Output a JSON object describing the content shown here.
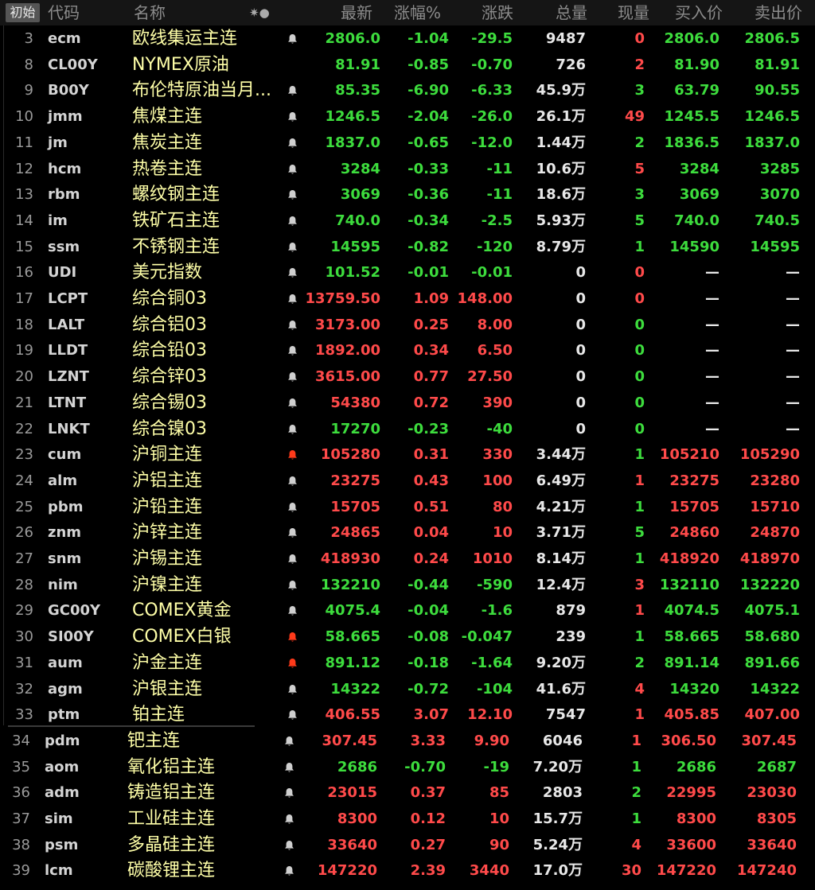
{
  "header": {
    "init_button": "初始",
    "columns": {
      "code": "代码",
      "name": "名称",
      "latest": "最新",
      "change_pct": "涨幅%",
      "change": "涨跌",
      "volume": "总量",
      "current_vol": "现量",
      "bid": "买入价",
      "ask": "卖出价"
    },
    "icons": "✷●"
  },
  "colors": {
    "up": "#ff4a4a",
    "down": "#3ddc3d",
    "name": "#ffffa8",
    "alert_bell": "#ff3a1a",
    "bell": "#cfcfcf"
  },
  "rows": [
    {
      "idx": "3",
      "code": "ecm",
      "name": "欧线集运主连",
      "latest": "2806.0",
      "pct": "-1.04",
      "chg": "-29.5",
      "vol": "9487",
      "cur": "0",
      "bid": "2806.0",
      "ask": "2806.5",
      "dir": "down",
      "bid_dir": "down",
      "ask_dir": "down",
      "cur_dir": "up",
      "bell": "normal"
    },
    {
      "idx": "8",
      "code": "CL00Y",
      "name": "NYMEX原油",
      "latest": "81.91",
      "pct": "-0.85",
      "chg": "-0.70",
      "vol": "726",
      "cur": "2",
      "bid": "81.90",
      "ask": "81.91",
      "dir": "down",
      "bid_dir": "down",
      "ask_dir": "down",
      "cur_dir": "up",
      "bell": "none"
    },
    {
      "idx": "9",
      "code": "B00Y",
      "name": "布伦特原油当月...",
      "latest": "85.35",
      "pct": "-6.90",
      "chg": "-6.33",
      "vol": "45.9万",
      "cur": "3",
      "bid": "63.79",
      "ask": "90.55",
      "dir": "down",
      "bid_dir": "down",
      "ask_dir": "down",
      "cur_dir": "down",
      "bell": "normal"
    },
    {
      "idx": "10",
      "code": "jmm",
      "name": "焦煤主连",
      "latest": "1246.5",
      "pct": "-2.04",
      "chg": "-26.0",
      "vol": "26.1万",
      "cur": "49",
      "bid": "1245.5",
      "ask": "1246.5",
      "dir": "down",
      "bid_dir": "down",
      "ask_dir": "down",
      "cur_dir": "up",
      "bell": "normal"
    },
    {
      "idx": "11",
      "code": "jm",
      "name": "焦炭主连",
      "latest": "1837.0",
      "pct": "-0.65",
      "chg": "-12.0",
      "vol": "1.44万",
      "cur": "2",
      "bid": "1836.5",
      "ask": "1837.0",
      "dir": "down",
      "bid_dir": "down",
      "ask_dir": "down",
      "cur_dir": "down",
      "bell": "normal"
    },
    {
      "idx": "12",
      "code": "hcm",
      "name": "热卷主连",
      "latest": "3284",
      "pct": "-0.33",
      "chg": "-11",
      "vol": "10.6万",
      "cur": "5",
      "bid": "3284",
      "ask": "3285",
      "dir": "down",
      "bid_dir": "down",
      "ask_dir": "down",
      "cur_dir": "up",
      "bell": "normal"
    },
    {
      "idx": "13",
      "code": "rbm",
      "name": "螺纹钢主连",
      "latest": "3069",
      "pct": "-0.36",
      "chg": "-11",
      "vol": "18.6万",
      "cur": "3",
      "bid": "3069",
      "ask": "3070",
      "dir": "down",
      "bid_dir": "down",
      "ask_dir": "down",
      "cur_dir": "down",
      "bell": "normal"
    },
    {
      "idx": "14",
      "code": "im",
      "name": "铁矿石主连",
      "latest": "740.0",
      "pct": "-0.34",
      "chg": "-2.5",
      "vol": "5.93万",
      "cur": "5",
      "bid": "740.0",
      "ask": "740.5",
      "dir": "down",
      "bid_dir": "down",
      "ask_dir": "down",
      "cur_dir": "down",
      "bell": "normal"
    },
    {
      "idx": "15",
      "code": "ssm",
      "name": "不锈钢主连",
      "latest": "14595",
      "pct": "-0.82",
      "chg": "-120",
      "vol": "8.79万",
      "cur": "1",
      "bid": "14590",
      "ask": "14595",
      "dir": "down",
      "bid_dir": "down",
      "ask_dir": "down",
      "cur_dir": "down",
      "bell": "normal"
    },
    {
      "idx": "16",
      "code": "UDI",
      "name": "美元指数",
      "latest": "101.52",
      "pct": "-0.01",
      "chg": "-0.01",
      "vol": "0",
      "cur": "0",
      "bid": "—",
      "ask": "—",
      "dir": "down",
      "bid_dir": "neutral",
      "ask_dir": "neutral",
      "cur_dir": "up",
      "bell": "normal"
    },
    {
      "idx": "17",
      "code": "LCPT",
      "name": "综合铜03",
      "latest": "13759.50",
      "pct": "1.09",
      "chg": "148.00",
      "vol": "0",
      "cur": "0",
      "bid": "—",
      "ask": "—",
      "dir": "up",
      "bid_dir": "neutral",
      "ask_dir": "neutral",
      "cur_dir": "up",
      "bell": "normal"
    },
    {
      "idx": "18",
      "code": "LALT",
      "name": "综合铝03",
      "latest": "3173.00",
      "pct": "0.25",
      "chg": "8.00",
      "vol": "0",
      "cur": "0",
      "bid": "—",
      "ask": "—",
      "dir": "up",
      "bid_dir": "neutral",
      "ask_dir": "neutral",
      "cur_dir": "down",
      "bell": "normal"
    },
    {
      "idx": "19",
      "code": "LLDT",
      "name": "综合铅03",
      "latest": "1892.00",
      "pct": "0.34",
      "chg": "6.50",
      "vol": "0",
      "cur": "0",
      "bid": "—",
      "ask": "—",
      "dir": "up",
      "bid_dir": "neutral",
      "ask_dir": "neutral",
      "cur_dir": "down",
      "bell": "normal"
    },
    {
      "idx": "20",
      "code": "LZNT",
      "name": "综合锌03",
      "latest": "3615.00",
      "pct": "0.77",
      "chg": "27.50",
      "vol": "0",
      "cur": "0",
      "bid": "—",
      "ask": "—",
      "dir": "up",
      "bid_dir": "neutral",
      "ask_dir": "neutral",
      "cur_dir": "down",
      "bell": "normal"
    },
    {
      "idx": "21",
      "code": "LTNT",
      "name": "综合锡03",
      "latest": "54380",
      "pct": "0.72",
      "chg": "390",
      "vol": "0",
      "cur": "0",
      "bid": "—",
      "ask": "—",
      "dir": "up",
      "bid_dir": "neutral",
      "ask_dir": "neutral",
      "cur_dir": "down",
      "bell": "normal"
    },
    {
      "idx": "22",
      "code": "LNKT",
      "name": "综合镍03",
      "latest": "17270",
      "pct": "-0.23",
      "chg": "-40",
      "vol": "0",
      "cur": "0",
      "bid": "—",
      "ask": "—",
      "dir": "down",
      "bid_dir": "neutral",
      "ask_dir": "neutral",
      "cur_dir": "down",
      "bell": "normal"
    },
    {
      "idx": "23",
      "code": "cum",
      "name": "沪铜主连",
      "latest": "105280",
      "pct": "0.31",
      "chg": "330",
      "vol": "3.44万",
      "cur": "1",
      "bid": "105210",
      "ask": "105290",
      "dir": "up",
      "bid_dir": "up",
      "ask_dir": "up",
      "cur_dir": "down",
      "bell": "alert"
    },
    {
      "idx": "24",
      "code": "alm",
      "name": "沪铝主连",
      "latest": "23275",
      "pct": "0.43",
      "chg": "100",
      "vol": "6.49万",
      "cur": "1",
      "bid": "23275",
      "ask": "23280",
      "dir": "up",
      "bid_dir": "up",
      "ask_dir": "up",
      "cur_dir": "up",
      "bell": "normal"
    },
    {
      "idx": "25",
      "code": "pbm",
      "name": "沪铅主连",
      "latest": "15705",
      "pct": "0.51",
      "chg": "80",
      "vol": "4.21万",
      "cur": "1",
      "bid": "15705",
      "ask": "15710",
      "dir": "up",
      "bid_dir": "up",
      "ask_dir": "up",
      "cur_dir": "down",
      "bell": "normal"
    },
    {
      "idx": "26",
      "code": "znm",
      "name": "沪锌主连",
      "latest": "24865",
      "pct": "0.04",
      "chg": "10",
      "vol": "3.71万",
      "cur": "5",
      "bid": "24860",
      "ask": "24870",
      "dir": "up",
      "bid_dir": "up",
      "ask_dir": "up",
      "cur_dir": "down",
      "bell": "normal"
    },
    {
      "idx": "27",
      "code": "snm",
      "name": "沪锡主连",
      "latest": "418930",
      "pct": "0.24",
      "chg": "1010",
      "vol": "8.14万",
      "cur": "1",
      "bid": "418920",
      "ask": "418970",
      "dir": "up",
      "bid_dir": "up",
      "ask_dir": "up",
      "cur_dir": "down",
      "bell": "normal"
    },
    {
      "idx": "28",
      "code": "nim",
      "name": "沪镍主连",
      "latest": "132210",
      "pct": "-0.44",
      "chg": "-590",
      "vol": "12.4万",
      "cur": "3",
      "bid": "132110",
      "ask": "132220",
      "dir": "down",
      "bid_dir": "down",
      "ask_dir": "down",
      "cur_dir": "up",
      "bell": "normal"
    },
    {
      "idx": "29",
      "code": "GC00Y",
      "name": "COMEX黄金",
      "latest": "4075.4",
      "pct": "-0.04",
      "chg": "-1.6",
      "vol": "879",
      "cur": "1",
      "bid": "4074.5",
      "ask": "4075.1",
      "dir": "down",
      "bid_dir": "down",
      "ask_dir": "down",
      "cur_dir": "up",
      "bell": "normal"
    },
    {
      "idx": "30",
      "code": "SI00Y",
      "name": "COMEX白银",
      "latest": "58.665",
      "pct": "-0.08",
      "chg": "-0.047",
      "vol": "239",
      "cur": "1",
      "bid": "58.665",
      "ask": "58.680",
      "dir": "down",
      "bid_dir": "down",
      "ask_dir": "down",
      "cur_dir": "down",
      "bell": "alert"
    },
    {
      "idx": "31",
      "code": "aum",
      "name": "沪金主连",
      "latest": "891.12",
      "pct": "-0.18",
      "chg": "-1.64",
      "vol": "9.20万",
      "cur": "2",
      "bid": "891.14",
      "ask": "891.66",
      "dir": "down",
      "bid_dir": "down",
      "ask_dir": "down",
      "cur_dir": "down",
      "bell": "alert"
    },
    {
      "idx": "32",
      "code": "agm",
      "name": "沪银主连",
      "latest": "14322",
      "pct": "-0.72",
      "chg": "-104",
      "vol": "41.6万",
      "cur": "4",
      "bid": "14320",
      "ask": "14322",
      "dir": "down",
      "bid_dir": "down",
      "ask_dir": "down",
      "cur_dir": "up",
      "bell": "normal"
    },
    {
      "idx": "33",
      "code": "ptm",
      "name": "铂主连",
      "latest": "406.55",
      "pct": "3.07",
      "chg": "12.10",
      "vol": "7547",
      "cur": "1",
      "bid": "405.85",
      "ask": "407.00",
      "dir": "up",
      "bid_dir": "up",
      "ask_dir": "up",
      "cur_dir": "up",
      "bell": "normal"
    },
    {
      "idx": "34",
      "code": "pdm",
      "name": "钯主连",
      "latest": "307.45",
      "pct": "3.33",
      "chg": "9.90",
      "vol": "6046",
      "cur": "1",
      "bid": "306.50",
      "ask": "307.45",
      "dir": "up",
      "bid_dir": "up",
      "ask_dir": "up",
      "cur_dir": "up",
      "bell": "normal"
    },
    {
      "idx": "35",
      "code": "aom",
      "name": "氧化铝主连",
      "latest": "2686",
      "pct": "-0.70",
      "chg": "-19",
      "vol": "7.20万",
      "cur": "1",
      "bid": "2686",
      "ask": "2687",
      "dir": "down",
      "bid_dir": "down",
      "ask_dir": "down",
      "cur_dir": "down",
      "bell": "normal"
    },
    {
      "idx": "36",
      "code": "adm",
      "name": "铸造铝主连",
      "latest": "23015",
      "pct": "0.37",
      "chg": "85",
      "vol": "2803",
      "cur": "2",
      "bid": "22995",
      "ask": "23030",
      "dir": "up",
      "bid_dir": "up",
      "ask_dir": "up",
      "cur_dir": "down",
      "bell": "normal"
    },
    {
      "idx": "37",
      "code": "sim",
      "name": "工业硅主连",
      "latest": "8300",
      "pct": "0.12",
      "chg": "10",
      "vol": "15.7万",
      "cur": "1",
      "bid": "8300",
      "ask": "8305",
      "dir": "up",
      "bid_dir": "up",
      "ask_dir": "up",
      "cur_dir": "down",
      "bell": "normal"
    },
    {
      "idx": "38",
      "code": "psm",
      "name": "多晶硅主连",
      "latest": "33640",
      "pct": "0.27",
      "chg": "90",
      "vol": "5.24万",
      "cur": "4",
      "bid": "33600",
      "ask": "33640",
      "dir": "up",
      "bid_dir": "up",
      "ask_dir": "up",
      "cur_dir": "up",
      "bell": "normal"
    },
    {
      "idx": "39",
      "code": "lcm",
      "name": "碳酸锂主连",
      "latest": "147220",
      "pct": "2.39",
      "chg": "3440",
      "vol": "17.0万",
      "cur": "30",
      "bid": "147220",
      "ask": "147240",
      "dir": "up",
      "bid_dir": "up",
      "ask_dir": "up",
      "cur_dir": "up",
      "bell": "normal"
    }
  ]
}
